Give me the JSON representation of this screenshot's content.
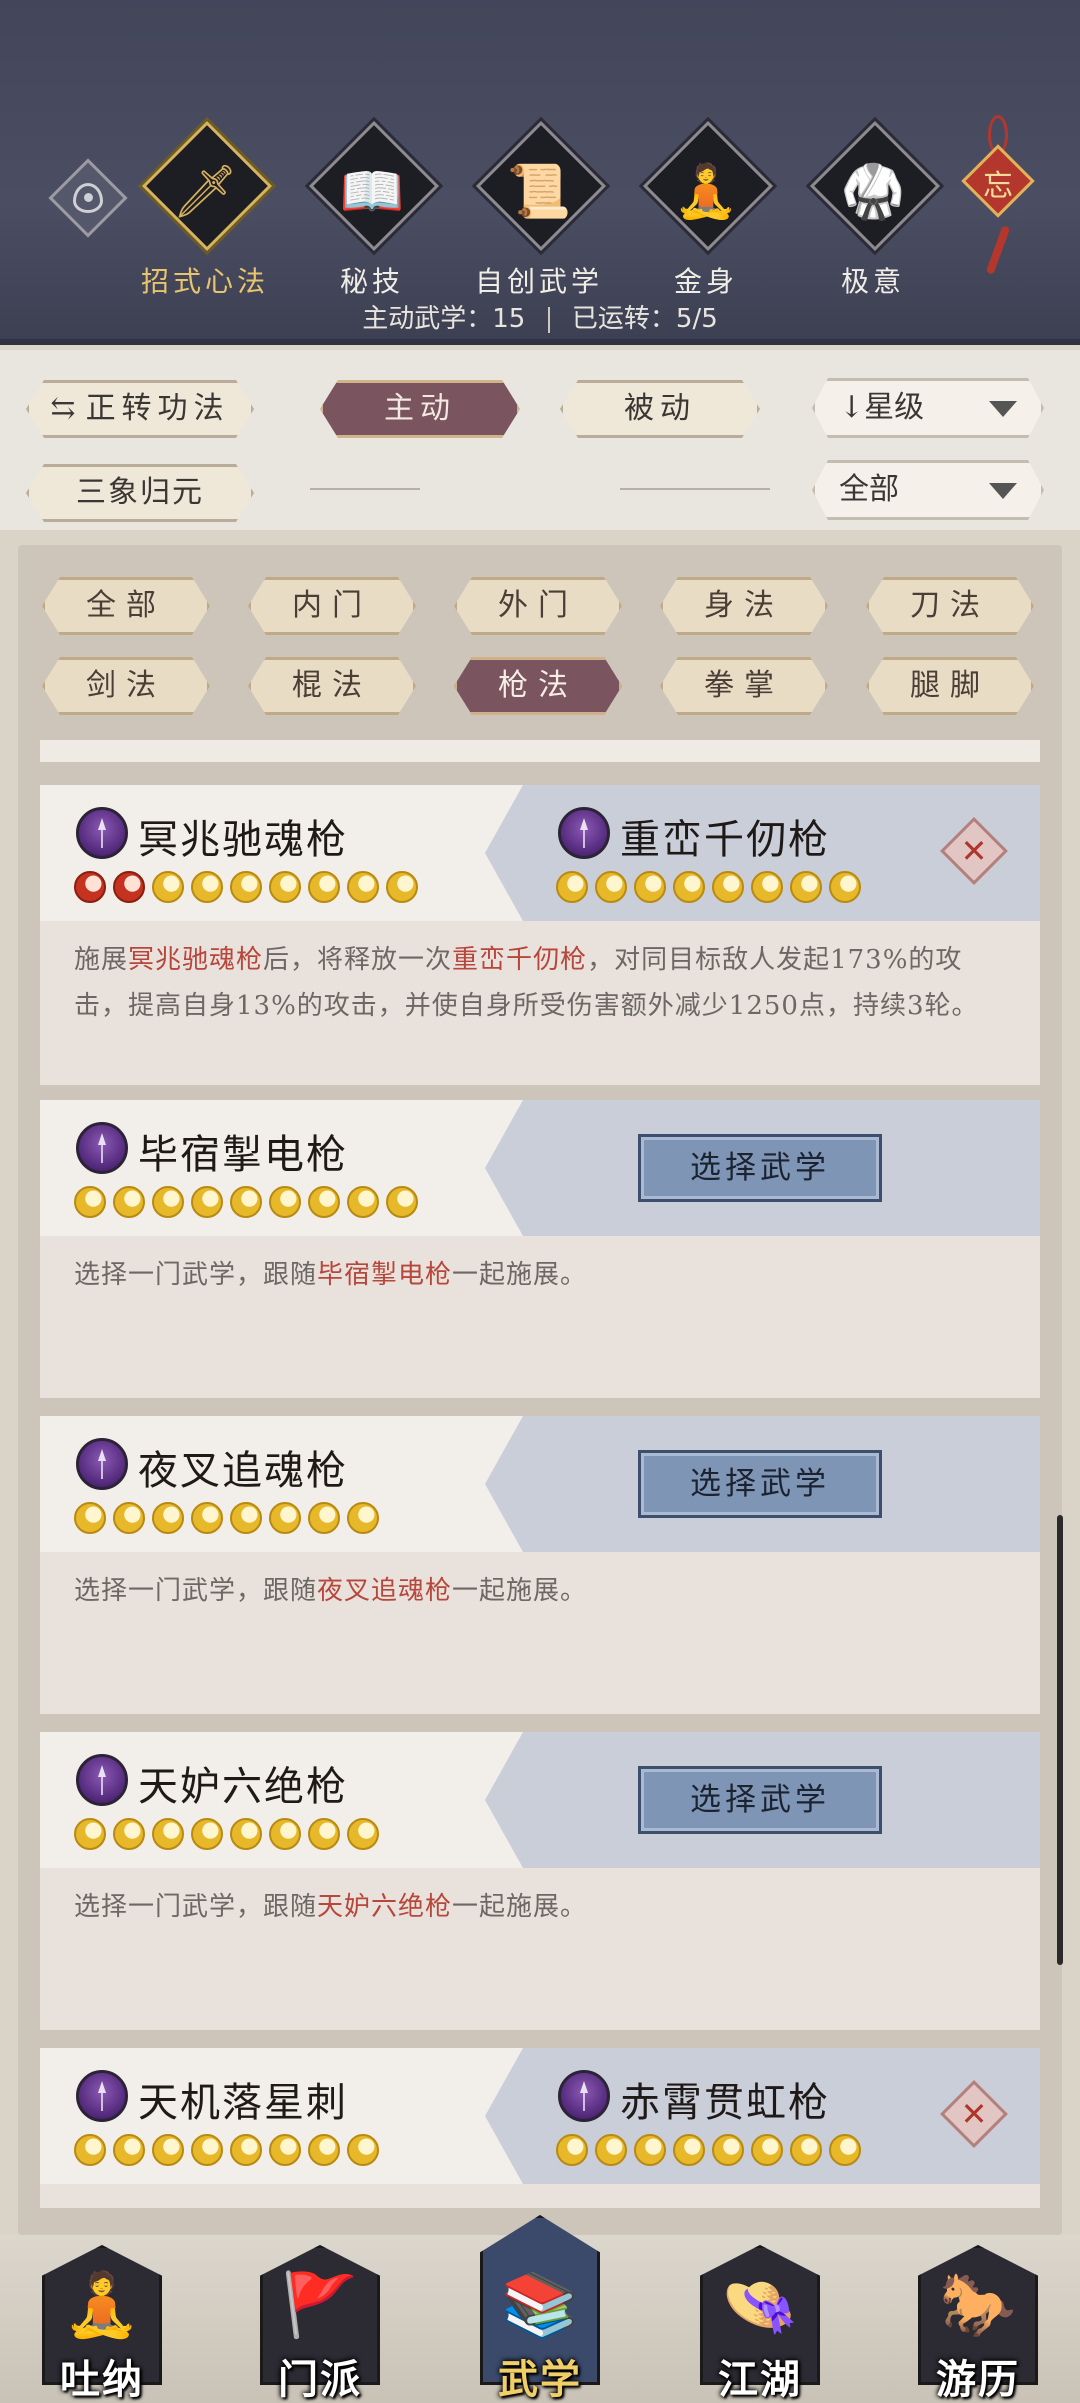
{
  "top_tabs": [
    {
      "label": "招式心法",
      "icon": "sword-icon",
      "glyph": "🗡",
      "active": true
    },
    {
      "label": "秘技",
      "icon": "book-icon",
      "glyph": "📖",
      "active": false
    },
    {
      "label": "自创武学",
      "icon": "scroll-icon",
      "glyph": "📜",
      "active": false
    },
    {
      "label": "金身",
      "icon": "meditation-icon",
      "glyph": "🧘",
      "active": false
    },
    {
      "label": "极意",
      "icon": "martial-stance-icon",
      "glyph": "🥋",
      "active": false
    }
  ],
  "knot_char": "忘",
  "status": {
    "active_label": "主动武学：",
    "active_count": "15",
    "running_label": "已运转：",
    "running_value": "5/5"
  },
  "filters": {
    "switch_label": "正转功法",
    "active_tab": "主动",
    "passive_tab": "被动",
    "sort_label": "星级",
    "extra_label": "三象归元",
    "scope_label": "全部"
  },
  "categories": [
    "全部",
    "内门",
    "外门",
    "身法",
    "刀法",
    "剑法",
    "棍法",
    "枪法",
    "拳掌",
    "腿脚"
  ],
  "selected_category": "枪法",
  "cards": [
    {
      "left_name": "冥兆驰魂枪",
      "left_stars": {
        "red": 2,
        "gold": 7
      },
      "right_name": "重峦千仞枪",
      "right_stars": {
        "red": 0,
        "gold": 8
      },
      "desc_parts": [
        {
          "t": "施展",
          "hl": false
        },
        {
          "t": "冥兆驰魂枪",
          "hl": true
        },
        {
          "t": "后，将释放一次",
          "hl": false
        },
        {
          "t": "重峦千仞枪",
          "hl": true
        },
        {
          "t": "，对同目标敌人发起173%的攻击，提高自身13%的攻击，并使自身所受伤害额外减少1250点，持续3轮。",
          "hl": false
        }
      ]
    },
    {
      "left_name": "毕宿掣电枪",
      "left_stars": {
        "red": 0,
        "gold": 9
      },
      "button": "选择武学",
      "desc_parts": [
        {
          "t": "选择一门武学，跟随",
          "hl": false
        },
        {
          "t": "毕宿掣电枪",
          "hl": true
        },
        {
          "t": "一起施展。",
          "hl": false
        }
      ]
    },
    {
      "left_name": "夜叉追魂枪",
      "left_stars": {
        "red": 0,
        "gold": 8
      },
      "button": "选择武学",
      "desc_parts": [
        {
          "t": "选择一门武学，跟随",
          "hl": false
        },
        {
          "t": "夜叉追魂枪",
          "hl": true
        },
        {
          "t": "一起施展。",
          "hl": false
        }
      ]
    },
    {
      "left_name": "天妒六绝枪",
      "left_stars": {
        "red": 0,
        "gold": 8
      },
      "button": "选择武学",
      "desc_parts": [
        {
          "t": "选择一门武学，跟随",
          "hl": false
        },
        {
          "t": "天妒六绝枪",
          "hl": true
        },
        {
          "t": "一起施展。",
          "hl": false
        }
      ]
    },
    {
      "left_name": "天机落星刺",
      "left_stars": {
        "red": 0,
        "gold": 8
      },
      "right_name": "赤霄贯虹枪",
      "right_stars": {
        "red": 0,
        "gold": 8
      }
    }
  ],
  "bottom_nav": [
    {
      "label": "吐纳",
      "icon": "monk-icon",
      "glyph": "🧘",
      "active": false
    },
    {
      "label": "门派",
      "icon": "sect-flags-icon",
      "glyph": "🚩",
      "active": false
    },
    {
      "label": "武学",
      "icon": "martial-books-icon",
      "glyph": "📚",
      "active": true
    },
    {
      "label": "江湖",
      "icon": "straw-hat-icon",
      "glyph": "👒",
      "active": false
    },
    {
      "label": "游历",
      "icon": "horse-icon",
      "glyph": "🐎",
      "active": false
    }
  ],
  "colors": {
    "top_bar": "#43465a",
    "selected_pill": "#7a5560",
    "highlight_text": "#b7463b",
    "select_button": "#7f95b5",
    "gold_star": "#e7b829",
    "red_star": "#c5321f"
  }
}
